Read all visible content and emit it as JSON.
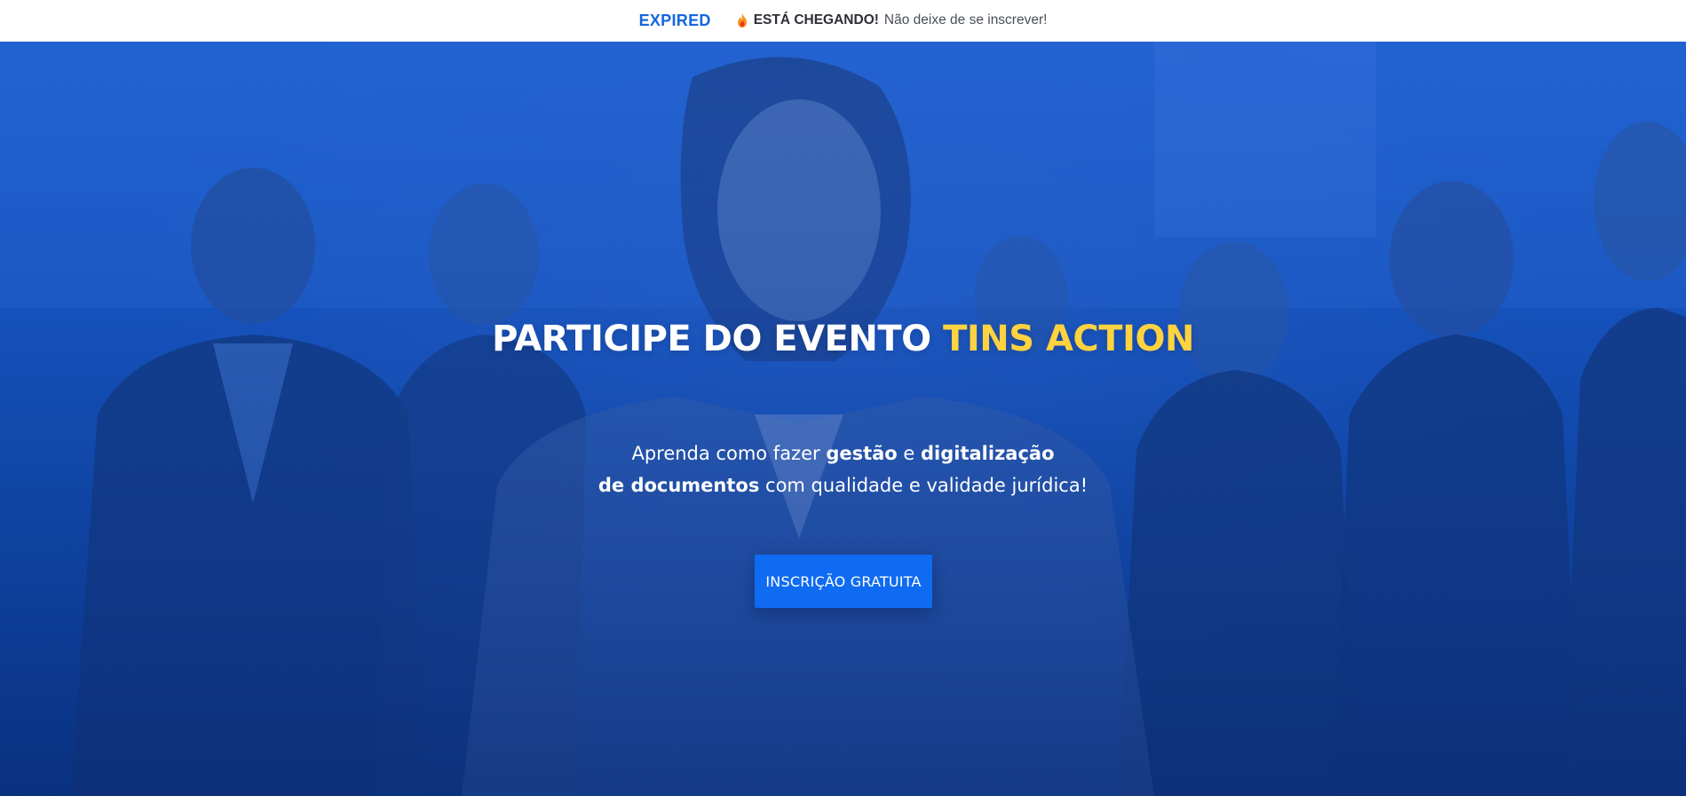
{
  "topbar": {
    "countdown_status": "EXPIRED",
    "announcement_icon": "fire-icon",
    "announcement_strong": "ESTÁ CHEGANDO!",
    "announcement_text": "Não deixe de se inscrever!"
  },
  "hero": {
    "headline_main": "PARTICIPE DO EVENTO",
    "headline_accent": "TINS ACTION",
    "subtitle": {
      "part1": "Aprenda como fazer ",
      "bold1": "gestão",
      "part2": " e ",
      "bold2": "digitalização",
      "bold3": "de documentos",
      "part3": " com qualidade e validade jurídica!"
    },
    "cta_label": "INSCRIÇÃO GRATUITA",
    "background_image": "group-of-business-people-photo"
  },
  "colors": {
    "accent_yellow": "#ffd23f",
    "brand_blue": "#1565e0",
    "button_blue": "#0f6bf2",
    "hero_overlay": "#1553be"
  }
}
